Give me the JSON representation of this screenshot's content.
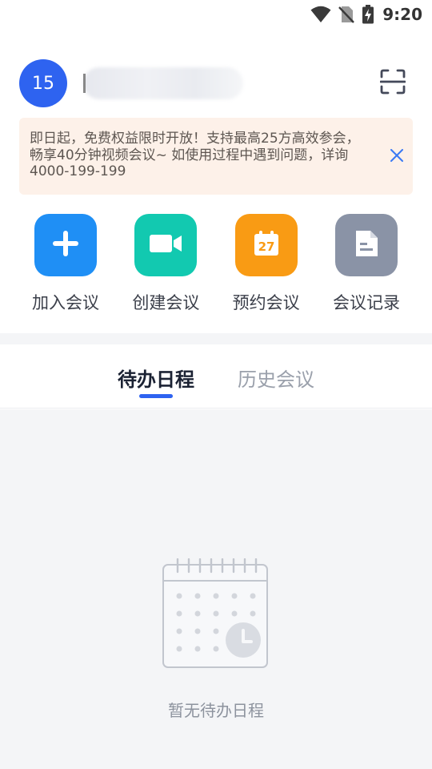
{
  "status_bar": {
    "time": "9:20",
    "icons": [
      "wifi-icon",
      "no-sim-icon",
      "battery-charging-icon"
    ]
  },
  "header": {
    "avatar_text": "15",
    "scan_icon": "scan-icon"
  },
  "notice": {
    "text": "即日起，免费权益限时开放！支持最高25方高效参会，畅享40分钟视频会议~ 如使用过程中遇到问题，详询4000-199-199",
    "close_icon": "close-icon",
    "background": "#fdf1e9"
  },
  "actions": [
    {
      "label": "加入会议",
      "icon": "plus-icon",
      "color": "#1f8ff5"
    },
    {
      "label": "创建会议",
      "icon": "video-camera-icon",
      "color": "#12c9b0"
    },
    {
      "label": "预约会议",
      "icon": "calendar-27-icon",
      "color": "#f99b14",
      "icon_text": "27"
    },
    {
      "label": "会议记录",
      "icon": "document-icon",
      "color": "#8a93a6"
    }
  ],
  "tabs": [
    {
      "label": "待办日程",
      "active": true
    },
    {
      "label": "历史会议",
      "active": false
    }
  ],
  "empty_state": {
    "icon": "empty-calendar-clock-icon",
    "text": "暂无待办日程"
  },
  "colors": {
    "accent": "#2e63f0",
    "content_background": "#f4f5f7"
  }
}
